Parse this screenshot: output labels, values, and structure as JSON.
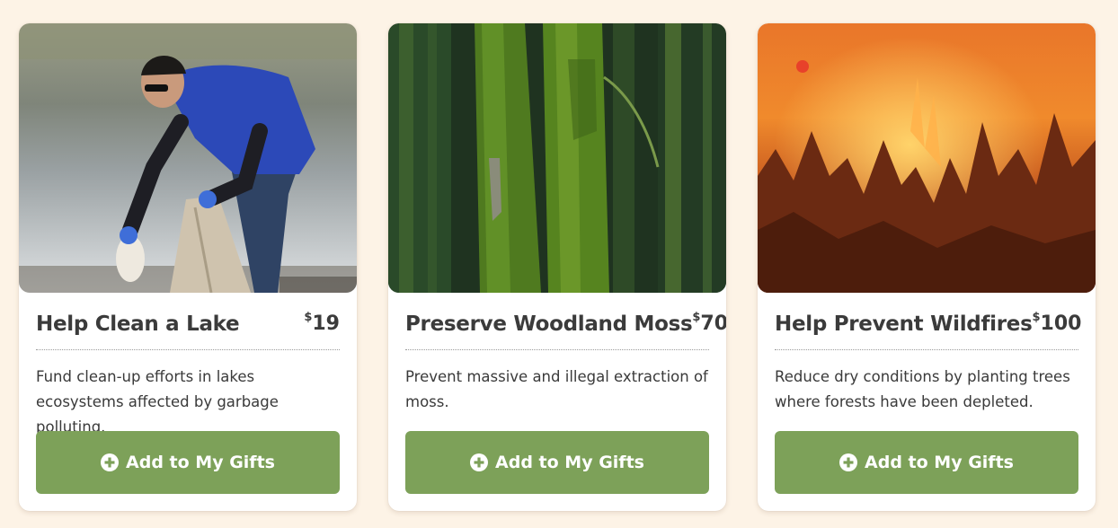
{
  "currency_symbol": "$",
  "button_label": "Add to My Gifts",
  "colors": {
    "background": "#fdf3e6",
    "button": "#7da159",
    "text": "#3b3b3b"
  },
  "cards": [
    {
      "image": "person-collecting-trash-at-lake",
      "title": "Help Clean a Lake",
      "price": "19",
      "description": "Fund clean-up efforts in lakes ecosystems affected by garbage polluting."
    },
    {
      "image": "mossy-forest-trees",
      "title": "Preserve Woodland Moss",
      "price": "70",
      "description": "Prevent massive and illegal extraction of moss."
    },
    {
      "image": "forest-wildfire",
      "title": "Help Prevent Wildfires",
      "price": "100",
      "description": "Reduce dry conditions by planting trees where forests have been depleted."
    }
  ]
}
